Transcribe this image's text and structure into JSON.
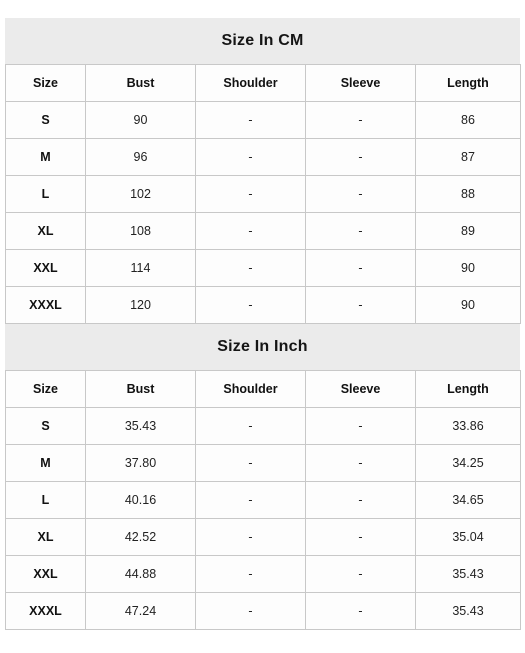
{
  "sections": [
    {
      "title": "Size In CM",
      "columns": [
        "Size",
        "Bust",
        "Shoulder",
        "Sleeve",
        "Length"
      ],
      "rows": [
        {
          "size": "S",
          "bust": "90",
          "shoulder": "-",
          "sleeve": "-",
          "length": "86"
        },
        {
          "size": "M",
          "bust": "96",
          "shoulder": "-",
          "sleeve": "-",
          "length": "87"
        },
        {
          "size": "L",
          "bust": "102",
          "shoulder": "-",
          "sleeve": "-",
          "length": "88"
        },
        {
          "size": "XL",
          "bust": "108",
          "shoulder": "-",
          "sleeve": "-",
          "length": "89"
        },
        {
          "size": "XXL",
          "bust": "114",
          "shoulder": "-",
          "sleeve": "-",
          "length": "90"
        },
        {
          "size": "XXXL",
          "bust": "120",
          "shoulder": "-",
          "sleeve": "-",
          "length": "90"
        }
      ]
    },
    {
      "title": "Size In Inch",
      "columns": [
        "Size",
        "Bust",
        "Shoulder",
        "Sleeve",
        "Length"
      ],
      "rows": [
        {
          "size": "S",
          "bust": "35.43",
          "shoulder": "-",
          "sleeve": "-",
          "length": "33.86"
        },
        {
          "size": "M",
          "bust": "37.80",
          "shoulder": "-",
          "sleeve": "-",
          "length": "34.25"
        },
        {
          "size": "L",
          "bust": "40.16",
          "shoulder": "-",
          "sleeve": "-",
          "length": "34.65"
        },
        {
          "size": "XL",
          "bust": "42.52",
          "shoulder": "-",
          "sleeve": "-",
          "length": "35.04"
        },
        {
          "size": "XXL",
          "bust": "44.88",
          "shoulder": "-",
          "sleeve": "-",
          "length": "35.43"
        },
        {
          "size": "XXXL",
          "bust": "47.24",
          "shoulder": "-",
          "sleeve": "-",
          "length": "35.43"
        }
      ]
    }
  ],
  "colors": {
    "band_background": "#ebebeb",
    "cell_background": "#fdfdfd",
    "border": "#c8c8c8",
    "text": "#1a1a1a"
  }
}
